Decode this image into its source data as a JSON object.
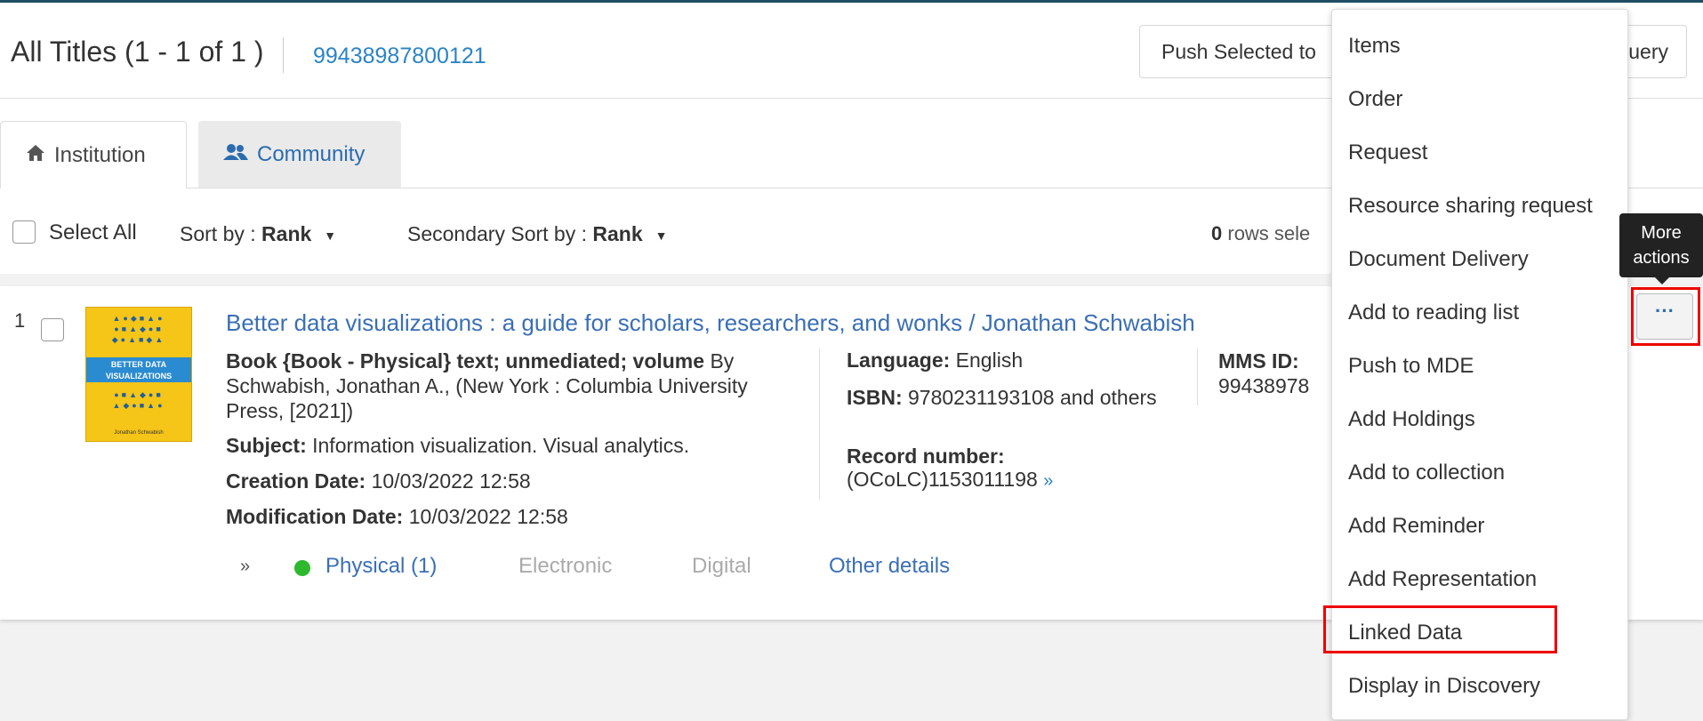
{
  "header": {
    "title": "All Titles (1 - 1 of 1 )",
    "mms_link": "99438987800121",
    "push_button_left": "Push Selected to",
    "push_button_right": "uery"
  },
  "tabs": [
    {
      "label": "Institution",
      "icon": "home-icon"
    },
    {
      "label": "Community",
      "icon": "users-icon"
    }
  ],
  "controls": {
    "select_all": "Select All",
    "sort_prefix": "Sort by : ",
    "sort_value": "Rank",
    "secondary_sort_prefix": "Secondary Sort by : ",
    "secondary_sort_value": "Rank",
    "rows_selected_count": "0",
    "rows_selected_text": " rows sele"
  },
  "result": {
    "row_number": "1",
    "cover": {
      "title_line1": "BETTER DATA",
      "title_line2": "VISUALIZATIONS",
      "author": "Jonathan Schwabish"
    },
    "title": "Better data visualizations : a guide for scholars, researchers, and wonks / Jonathan Schwabish",
    "description_bold": "Book {Book - Physical} text; unmediated; volume",
    "description_rest": " By Schwabish, Jonathan A., (New York : Columbia University Press, [2021])",
    "subject_label": "Subject:",
    "subject_value": " Information visualization. Visual analytics.",
    "creation_label": "Creation Date:",
    "creation_value": " 10/03/2022 12:58",
    "modification_label": "Modification Date:",
    "modification_value": " 10/03/2022 12:58",
    "language_label": "Language:",
    "language_value": " English",
    "isbn_label": "ISBN:",
    "isbn_value": " 9780231193108 and others",
    "record_label": "Record number:",
    "record_value": "(OCoLC)1153011198",
    "mms_label": "MMS ID:",
    "mms_value": "99438978",
    "physical": "Physical (1)",
    "electronic": "Electronic",
    "digital": "Digital",
    "other_details": "Other details"
  },
  "menu": {
    "items": [
      "Items",
      "Order",
      "Request",
      "Resource sharing request",
      "Document Delivery",
      "Add to reading list",
      "Push to MDE",
      "Add Holdings",
      "Add to collection",
      "Add Reminder",
      "Add Representation",
      "Linked Data",
      "Display in Discovery"
    ],
    "highlighted": "Linked Data"
  },
  "more_actions": {
    "button_label": "···",
    "tooltip_line1": "More",
    "tooltip_line2": "actions"
  },
  "colors": {
    "link": "#3a6fb5",
    "highlight": "#e00000",
    "available": "#2eb82e"
  }
}
